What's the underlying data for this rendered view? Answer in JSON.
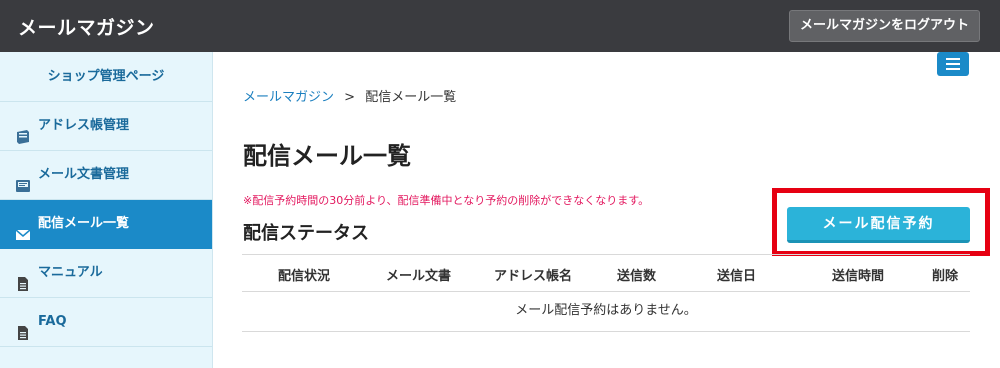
{
  "header": {
    "app_title": "メールマガジン",
    "logout_label": "メールマガジンをログアウト"
  },
  "sidebar": {
    "shop_link": "ショップ管理ページ",
    "items": [
      {
        "label": "アドレス帳管理",
        "icon": "book-icon"
      },
      {
        "label": "メール文書管理",
        "icon": "document-tray-icon"
      },
      {
        "label": "配信メール一覧",
        "icon": "envelope-icon",
        "active": true
      },
      {
        "label": "マニュアル",
        "icon": "file-icon"
      },
      {
        "label": "FAQ",
        "icon": "file-icon"
      }
    ]
  },
  "breadcrumb": {
    "link": "メールマガジン",
    "separator": ">",
    "current": "配信メール一覧"
  },
  "main": {
    "page_title": "配信メール一覧",
    "notice": "※配信予約時間の30分前より、配信準備中となり予約の削除ができなくなります。",
    "section_title": "配信ステータス",
    "reserve_button": "メール配信予約"
  },
  "table": {
    "columns": [
      "配信状況",
      "メール文書",
      "アドレス帳名",
      "送信数",
      "送信日",
      "送信時間",
      "削除"
    ],
    "empty_message": "メール配信予約はありません。"
  },
  "colors": {
    "topbar": "#3a3b3f",
    "accent": "#1b8ac8",
    "reserve_button": "#2bb3d9",
    "notice": "#e3185f",
    "highlight": "#e60012"
  }
}
